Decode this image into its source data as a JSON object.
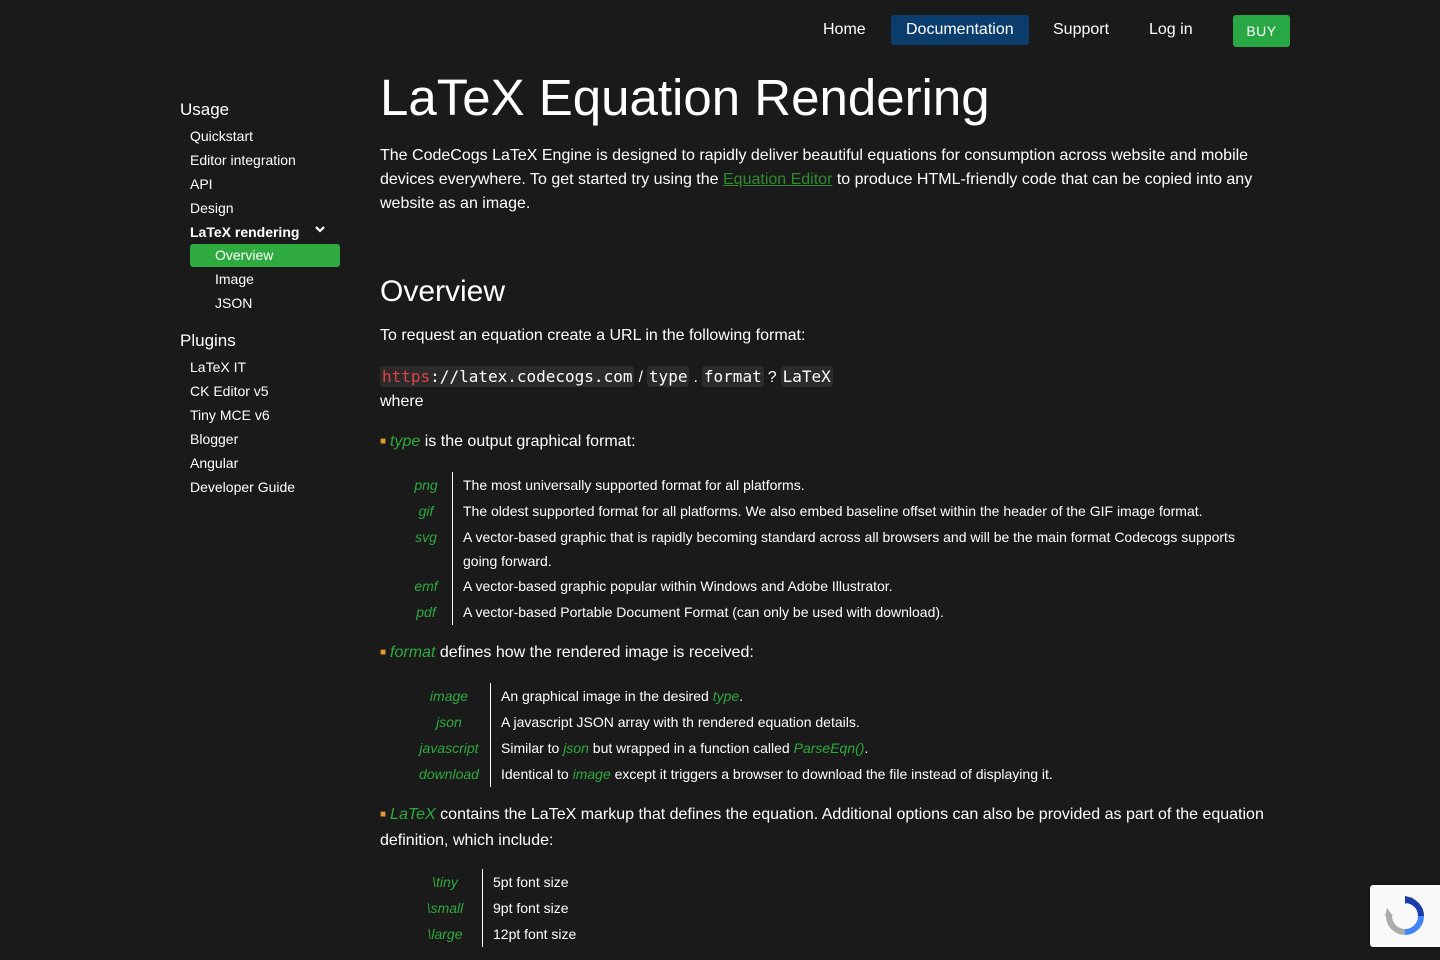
{
  "nav": {
    "home": "Home",
    "documentation": "Documentation",
    "support": "Support",
    "login": "Log in",
    "buy": "BUY"
  },
  "sidebar": {
    "usage_heading": "Usage",
    "usage_items": [
      "Quickstart",
      "Editor integration",
      "API",
      "Design"
    ],
    "latex_rendering": "LaTeX rendering",
    "latex_sub": [
      "Overview",
      "Image",
      "JSON"
    ],
    "plugins_heading": "Plugins",
    "plugin_items": [
      "LaTeX IT",
      "CK Editor v5",
      "Tiny MCE v6",
      "Blogger",
      "Angular",
      "Developer Guide"
    ]
  },
  "main": {
    "title": "LaTeX Equation Rendering",
    "intro_a": "The CodeCogs LaTeX Engine is designed to rapidly deliver beautiful equations for consumption across website and mobile devices everywhere. To get started try using the ",
    "intro_link": "Equation Editor",
    "intro_b": " to produce HTML-friendly code that can be copied into any website as an image.",
    "overview_heading": "Overview",
    "request_text": "To request an equation create a URL in the following format:",
    "url": {
      "scheme": "https",
      "host": "://latex.codecogs.com",
      "slash": "/",
      "type": "type",
      "dot": ".",
      "format": "format",
      "q": "?",
      "latex": "LaTeX"
    },
    "where": "where",
    "type_bullet": {
      "term": "type",
      "text": " is the output graphical format:"
    },
    "type_table": [
      {
        "key": "png",
        "val": "The most universally supported format for all platforms."
      },
      {
        "key": "gif",
        "val": "The oldest supported format for all platforms. We also embed baseline offset within the header of the GIF image format."
      },
      {
        "key": "svg",
        "val": "A vector-based graphic that is rapidly becoming standard across all browsers and will be the main format Codecogs supports going forward."
      },
      {
        "key": "emf",
        "val": "A vector-based graphic popular within Windows and Adobe Illustrator."
      },
      {
        "key": "pdf",
        "val": "A vector-based Portable Document Format (can only be used with download)."
      }
    ],
    "format_bullet": {
      "term": "format",
      "text": " defines how the rendered image is received:"
    },
    "format_table": {
      "image": {
        "key": "image",
        "a": "An graphical image in the desired ",
        "em": "type",
        "b": "."
      },
      "json": {
        "key": "json",
        "val": "A javascript JSON array with th rendered equation details."
      },
      "javascript": {
        "key": "javascript",
        "a": "Similar to ",
        "em1": "json",
        "b": " but wrapped in a function called ",
        "em2": "ParseEqn()",
        "c": "."
      },
      "download": {
        "key": "download",
        "a": "Identical to ",
        "em": "image",
        "b": " except it triggers a browser to download the file instead of displaying it."
      }
    },
    "latex_bullet": {
      "term": "LaTeX",
      "text": " contains the LaTeX markup that defines the equation. Additional options can also be provided as part of the equation definition, which include:"
    },
    "size_table": [
      {
        "key": "\\tiny",
        "val": "5pt font size"
      },
      {
        "key": "\\small",
        "val": "9pt font size"
      },
      {
        "key": "\\large",
        "val": "12pt font size"
      }
    ]
  },
  "colors": {
    "background": "#1a1a1a",
    "accent_green": "#2eaa3e",
    "nav_active": "#0a3d6b",
    "bullet_orange": "#e39a2d",
    "code_red": "#e0404a"
  }
}
